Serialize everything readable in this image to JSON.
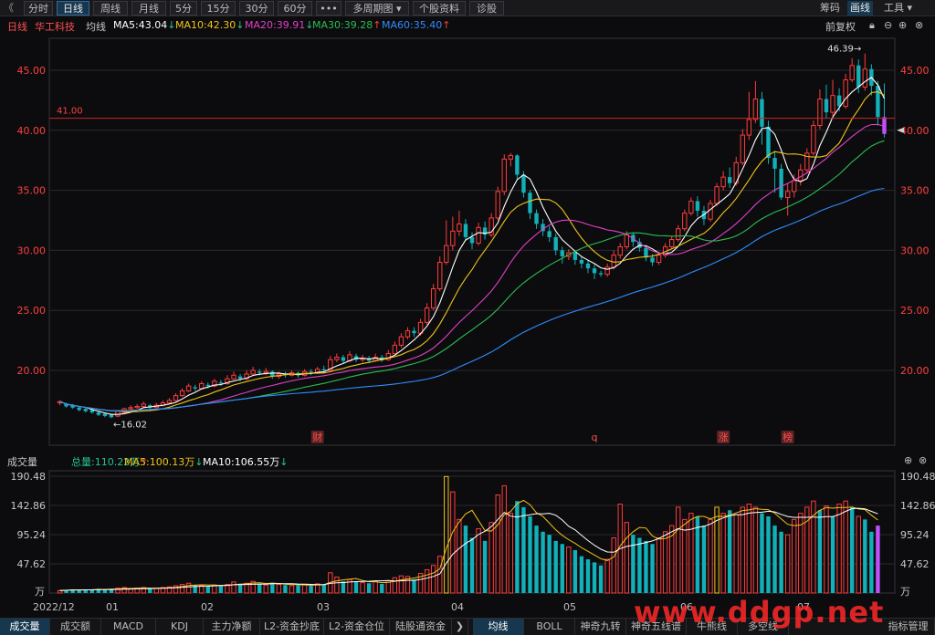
{
  "toolbar": {
    "back_glyph": "《",
    "tabs": [
      "分时",
      "日线",
      "周线",
      "月线",
      "5分",
      "15分",
      "30分",
      "60分",
      "•••",
      "多周期图 ▾",
      "个股资料",
      "诊股"
    ],
    "active_tab": "日线",
    "right": {
      "chip": "筹码",
      "draw": "画线",
      "tools": "工具 ▾"
    }
  },
  "ma_bar": {
    "period": "日线",
    "stock_name": "华工科技",
    "avg_label": "均线",
    "ma5": "MA5:43.04",
    "ma10": "MA10:42.30",
    "ma20": "MA20:39.91",
    "ma30": "MA30:39.28",
    "ma60": "MA60:35.40",
    "right_label": "前复权"
  },
  "colors": {
    "up": "#ff3c3c",
    "down": "#12b0b8",
    "ma5": "#ffffff",
    "ma10": "#f0c419",
    "ma20": "#e040c8",
    "ma30": "#2bbd52",
    "ma60": "#2f8cff",
    "grid": "#2a2a2e",
    "hline": "#c82828"
  },
  "price_axis": {
    "ticks": [
      "45.00",
      "40.00",
      "35.00",
      "30.00",
      "25.00",
      "20.00"
    ]
  },
  "annotations": {
    "hline_label": "41.00",
    "max_label": "46.39→",
    "min_label": "←16.02",
    "events": [
      "财",
      "q",
      "涨",
      "榜"
    ]
  },
  "volume": {
    "title": "成交量",
    "total": "总量:110.22万",
    "ma5": "MA5:100.13万",
    "ma10": "MA10:106.55万",
    "ticks": [
      "190.48",
      "142.86",
      "95.24",
      "47.62"
    ],
    "unit": "万"
  },
  "dates": [
    "2022/12",
    "01",
    "02",
    "03",
    "04",
    "05",
    "06",
    "07"
  ],
  "bottom_tabs": {
    "left": [
      "成交量",
      "成交额",
      "MACD",
      "KDJ",
      "主力净额",
      "L2-资金抄底",
      "L2-资金仓位",
      "陆股通资金"
    ],
    "right": [
      "均线",
      "BOLL",
      "神奇九转",
      "神奇五线谱",
      "牛熊线",
      "多空线",
      "指标管理"
    ]
  },
  "watermark": "www.ddgp.net",
  "chart_data": {
    "type": "candlestick",
    "ylim": [
      16,
      47
    ],
    "legend": "top-left",
    "candles": [
      [
        17.3,
        17.4,
        17.5,
        17.1
      ],
      [
        17.2,
        17.0,
        17.3,
        16.9
      ],
      [
        17.1,
        16.9,
        17.2,
        16.8
      ],
      [
        16.9,
        16.7,
        17.0,
        16.6
      ],
      [
        16.8,
        16.6,
        16.9,
        16.5
      ],
      [
        16.7,
        16.5,
        16.8,
        16.4
      ],
      [
        16.5,
        16.3,
        16.6,
        16.2
      ],
      [
        16.4,
        16.2,
        16.5,
        16.1
      ],
      [
        16.3,
        16.1,
        16.4,
        16.02
      ],
      [
        16.2,
        16.6,
        16.7,
        16.1
      ],
      [
        16.5,
        16.8,
        16.9,
        16.4
      ],
      [
        16.8,
        16.9,
        17.1,
        16.7
      ],
      [
        16.9,
        17.0,
        17.2,
        16.8
      ],
      [
        17.0,
        17.2,
        17.4,
        16.9
      ],
      [
        17.1,
        16.9,
        17.2,
        16.8
      ],
      [
        16.9,
        17.1,
        17.3,
        16.8
      ],
      [
        17.1,
        17.3,
        17.5,
        17.0
      ],
      [
        17.3,
        17.5,
        17.7,
        17.2
      ],
      [
        17.5,
        17.9,
        18.1,
        17.4
      ],
      [
        17.9,
        18.3,
        18.5,
        17.8
      ],
      [
        18.3,
        18.7,
        18.9,
        18.2
      ],
      [
        18.6,
        18.5,
        18.8,
        18.3
      ],
      [
        18.5,
        18.9,
        19.1,
        18.4
      ],
      [
        18.8,
        18.7,
        19.0,
        18.5
      ],
      [
        18.7,
        19.1,
        19.3,
        18.6
      ],
      [
        19.0,
        18.9,
        19.2,
        18.7
      ],
      [
        18.9,
        19.3,
        19.6,
        18.8
      ],
      [
        19.3,
        19.6,
        19.9,
        19.2
      ],
      [
        19.5,
        19.3,
        19.7,
        19.1
      ],
      [
        19.3,
        19.7,
        20.0,
        19.2
      ],
      [
        19.7,
        20.0,
        20.3,
        19.6
      ],
      [
        19.9,
        19.8,
        20.1,
        19.6
      ],
      [
        19.8,
        19.9,
        20.2,
        19.6
      ],
      [
        19.9,
        19.5,
        20.0,
        19.3
      ],
      [
        19.5,
        19.7,
        19.9,
        19.3
      ],
      [
        19.7,
        19.6,
        19.9,
        19.4
      ],
      [
        19.6,
        19.8,
        20.0,
        19.5
      ],
      [
        19.8,
        19.6,
        19.9,
        19.4
      ],
      [
        19.6,
        19.9,
        20.1,
        19.5
      ],
      [
        19.9,
        19.8,
        20.1,
        19.6
      ],
      [
        19.8,
        20.1,
        20.3,
        19.7
      ],
      [
        20.1,
        20.0,
        20.4,
        19.8
      ],
      [
        20.0,
        20.9,
        21.2,
        19.9
      ],
      [
        20.9,
        21.1,
        21.4,
        20.7
      ],
      [
        21.1,
        20.8,
        21.3,
        20.6
      ],
      [
        20.8,
        21.3,
        21.6,
        20.7
      ],
      [
        21.2,
        20.9,
        21.4,
        20.7
      ],
      [
        20.9,
        21.0,
        21.3,
        20.7
      ],
      [
        21.0,
        20.8,
        21.2,
        20.6
      ],
      [
        20.8,
        21.1,
        21.4,
        20.7
      ],
      [
        21.1,
        20.9,
        21.3,
        20.7
      ],
      [
        20.9,
        21.4,
        21.7,
        20.8
      ],
      [
        21.4,
        22.1,
        22.4,
        21.3
      ],
      [
        22.1,
        22.8,
        23.1,
        21.9
      ],
      [
        22.8,
        23.3,
        23.6,
        22.6
      ],
      [
        23.3,
        23.1,
        23.6,
        22.8
      ],
      [
        23.1,
        24.0,
        24.3,
        22.9
      ],
      [
        24.0,
        25.2,
        25.6,
        23.8
      ],
      [
        25.2,
        26.8,
        27.2,
        25.0
      ],
      [
        26.8,
        29.0,
        29.5,
        26.6
      ],
      [
        29.0,
        30.4,
        32.5,
        28.8
      ],
      [
        30.4,
        31.6,
        32.8,
        30.0
      ],
      [
        31.6,
        32.2,
        33.3,
        31.2
      ],
      [
        32.2,
        31.1,
        32.6,
        30.8
      ],
      [
        31.1,
        30.6,
        31.5,
        30.1
      ],
      [
        30.6,
        31.9,
        32.3,
        30.4
      ],
      [
        31.9,
        31.3,
        32.4,
        30.9
      ],
      [
        31.3,
        32.7,
        33.1,
        31.1
      ],
      [
        32.7,
        34.9,
        35.3,
        32.5
      ],
      [
        34.9,
        37.6,
        38.0,
        34.6
      ],
      [
        37.6,
        37.9,
        38.1,
        37.0
      ],
      [
        37.9,
        36.3,
        38.0,
        35.9
      ],
      [
        36.3,
        34.8,
        36.6,
        34.4
      ],
      [
        34.8,
        33.1,
        35.0,
        32.6
      ],
      [
        33.1,
        32.2,
        33.4,
        31.8
      ],
      [
        32.2,
        31.6,
        32.6,
        31.2
      ],
      [
        31.6,
        31.1,
        32.0,
        30.7
      ],
      [
        31.1,
        30.0,
        31.4,
        29.6
      ],
      [
        30.0,
        29.5,
        30.3,
        28.9
      ],
      [
        29.5,
        29.8,
        30.1,
        29.2
      ],
      [
        29.8,
        29.2,
        30.0,
        28.8
      ],
      [
        29.2,
        28.9,
        29.5,
        28.5
      ],
      [
        28.9,
        28.5,
        29.2,
        28.1
      ],
      [
        28.5,
        28.1,
        28.8,
        27.6
      ],
      [
        28.1,
        28.0,
        28.3,
        27.8
      ],
      [
        28.0,
        28.6,
        28.9,
        27.8
      ],
      [
        28.6,
        29.6,
        30.0,
        28.4
      ],
      [
        29.6,
        30.3,
        30.6,
        29.3
      ],
      [
        30.3,
        31.3,
        31.6,
        30.1
      ],
      [
        31.3,
        30.7,
        31.5,
        30.3
      ],
      [
        30.7,
        30.2,
        31.0,
        29.9
      ],
      [
        30.2,
        29.4,
        30.4,
        29.1
      ],
      [
        29.4,
        29.0,
        29.7,
        28.7
      ],
      [
        29.0,
        29.6,
        29.9,
        28.8
      ],
      [
        29.6,
        30.3,
        30.6,
        29.4
      ],
      [
        30.3,
        30.9,
        31.2,
        30.1
      ],
      [
        30.9,
        31.8,
        32.1,
        30.7
      ],
      [
        31.8,
        33.1,
        33.4,
        31.6
      ],
      [
        33.1,
        34.1,
        34.4,
        32.9
      ],
      [
        34.1,
        33.3,
        34.5,
        32.8
      ],
      [
        33.3,
        32.6,
        33.7,
        32.1
      ],
      [
        32.6,
        33.9,
        34.2,
        32.4
      ],
      [
        33.9,
        35.3,
        35.6,
        33.7
      ],
      [
        35.3,
        36.1,
        36.6,
        35.0
      ],
      [
        36.1,
        35.6,
        36.9,
        35.2
      ],
      [
        35.6,
        37.3,
        37.8,
        35.4
      ],
      [
        37.3,
        39.6,
        40.1,
        37.1
      ],
      [
        39.6,
        40.9,
        43.2,
        39.2
      ],
      [
        40.9,
        42.6,
        44.1,
        40.6
      ],
      [
        42.6,
        40.3,
        43.2,
        38.8
      ],
      [
        40.3,
        37.7,
        40.8,
        37.2
      ],
      [
        37.7,
        36.8,
        38.3,
        34.8
      ],
      [
        36.8,
        34.4,
        37.2,
        34.2
      ],
      [
        34.4,
        34.9,
        35.6,
        32.9
      ],
      [
        34.9,
        35.8,
        36.3,
        34.4
      ],
      [
        35.8,
        36.7,
        37.2,
        35.4
      ],
      [
        36.7,
        38.1,
        38.5,
        36.4
      ],
      [
        38.1,
        40.4,
        40.8,
        37.9
      ],
      [
        40.4,
        42.6,
        43.4,
        40.1
      ],
      [
        42.6,
        41.5,
        43.8,
        41.0
      ],
      [
        41.5,
        42.9,
        44.2,
        41.2
      ],
      [
        42.9,
        42.0,
        43.5,
        41.6
      ],
      [
        42.0,
        44.2,
        44.7,
        41.8
      ],
      [
        44.2,
        45.4,
        46.0,
        44.0
      ],
      [
        45.4,
        43.6,
        45.9,
        43.1
      ],
      [
        43.6,
        45.1,
        46.39,
        43.3
      ],
      [
        45.1,
        43.7,
        45.5,
        42.9
      ],
      [
        43.7,
        41.1,
        44.1,
        40.4
      ],
      [
        41.1,
        39.7,
        43.9,
        39.4
      ]
    ],
    "volumes": [
      [
        4,
        1
      ],
      [
        5,
        0
      ],
      [
        6,
        0
      ],
      [
        5,
        0
      ],
      [
        6,
        0
      ],
      [
        5,
        0
      ],
      [
        7,
        0
      ],
      [
        6,
        0
      ],
      [
        7,
        0
      ],
      [
        8,
        1
      ],
      [
        9,
        1
      ],
      [
        7,
        1
      ],
      [
        8,
        1
      ],
      [
        9,
        1
      ],
      [
        7,
        0
      ],
      [
        8,
        1
      ],
      [
        9,
        1
      ],
      [
        10,
        1
      ],
      [
        12,
        1
      ],
      [
        14,
        1
      ],
      [
        16,
        1
      ],
      [
        13,
        0
      ],
      [
        12,
        1
      ],
      [
        11,
        0
      ],
      [
        13,
        1
      ],
      [
        12,
        0
      ],
      [
        14,
        1
      ],
      [
        18,
        1
      ],
      [
        15,
        0
      ],
      [
        16,
        1
      ],
      [
        19,
        1
      ],
      [
        15,
        0
      ],
      [
        13,
        1
      ],
      [
        17,
        0
      ],
      [
        14,
        1
      ],
      [
        13,
        0
      ],
      [
        12,
        1
      ],
      [
        13,
        0
      ],
      [
        14,
        1
      ],
      [
        12,
        0
      ],
      [
        15,
        1
      ],
      [
        14,
        0
      ],
      [
        33,
        1
      ],
      [
        26,
        1
      ],
      [
        19,
        0
      ],
      [
        22,
        1
      ],
      [
        18,
        0
      ],
      [
        17,
        1
      ],
      [
        16,
        0
      ],
      [
        19,
        1
      ],
      [
        15,
        0
      ],
      [
        20,
        1
      ],
      [
        25,
        1
      ],
      [
        28,
        1
      ],
      [
        27,
        1
      ],
      [
        22,
        0
      ],
      [
        32,
        1
      ],
      [
        38,
        1
      ],
      [
        45,
        1
      ],
      [
        60,
        1
      ],
      [
        190,
        1
      ],
      [
        165,
        1
      ],
      [
        120,
        1
      ],
      [
        110,
        0
      ],
      [
        90,
        0
      ],
      [
        105,
        1
      ],
      [
        85,
        0
      ],
      [
        115,
        1
      ],
      [
        160,
        1
      ],
      [
        175,
        1
      ],
      [
        130,
        1
      ],
      [
        150,
        0
      ],
      [
        140,
        0
      ],
      [
        125,
        0
      ],
      [
        110,
        0
      ],
      [
        100,
        0
      ],
      [
        95,
        0
      ],
      [
        85,
        0
      ],
      [
        80,
        0
      ],
      [
        75,
        1
      ],
      [
        70,
        0
      ],
      [
        60,
        0
      ],
      [
        55,
        0
      ],
      [
        50,
        0
      ],
      [
        45,
        0
      ],
      [
        55,
        1
      ],
      [
        90,
        1
      ],
      [
        145,
        1
      ],
      [
        115,
        1
      ],
      [
        95,
        0
      ],
      [
        90,
        0
      ],
      [
        85,
        0
      ],
      [
        80,
        0
      ],
      [
        90,
        1
      ],
      [
        100,
        1
      ],
      [
        110,
        1
      ],
      [
        140,
        1
      ],
      [
        120,
        1
      ],
      [
        130,
        1
      ],
      [
        125,
        0
      ],
      [
        110,
        0
      ],
      [
        120,
        1
      ],
      [
        140,
        1
      ],
      [
        130,
        1
      ],
      [
        135,
        0
      ],
      [
        128,
        1
      ],
      [
        140,
        1
      ],
      [
        145,
        1
      ],
      [
        140,
        1
      ],
      [
        130,
        0
      ],
      [
        125,
        0
      ],
      [
        110,
        0
      ],
      [
        100,
        0
      ],
      [
        95,
        1
      ],
      [
        120,
        1
      ],
      [
        130,
        1
      ],
      [
        140,
        1
      ],
      [
        150,
        1
      ],
      [
        135,
        0
      ],
      [
        142,
        1
      ],
      [
        125,
        0
      ],
      [
        145,
        1
      ],
      [
        150,
        1
      ],
      [
        140,
        0
      ],
      [
        125,
        1
      ],
      [
        120,
        0
      ],
      [
        100,
        0
      ],
      [
        110,
        0
      ]
    ]
  }
}
